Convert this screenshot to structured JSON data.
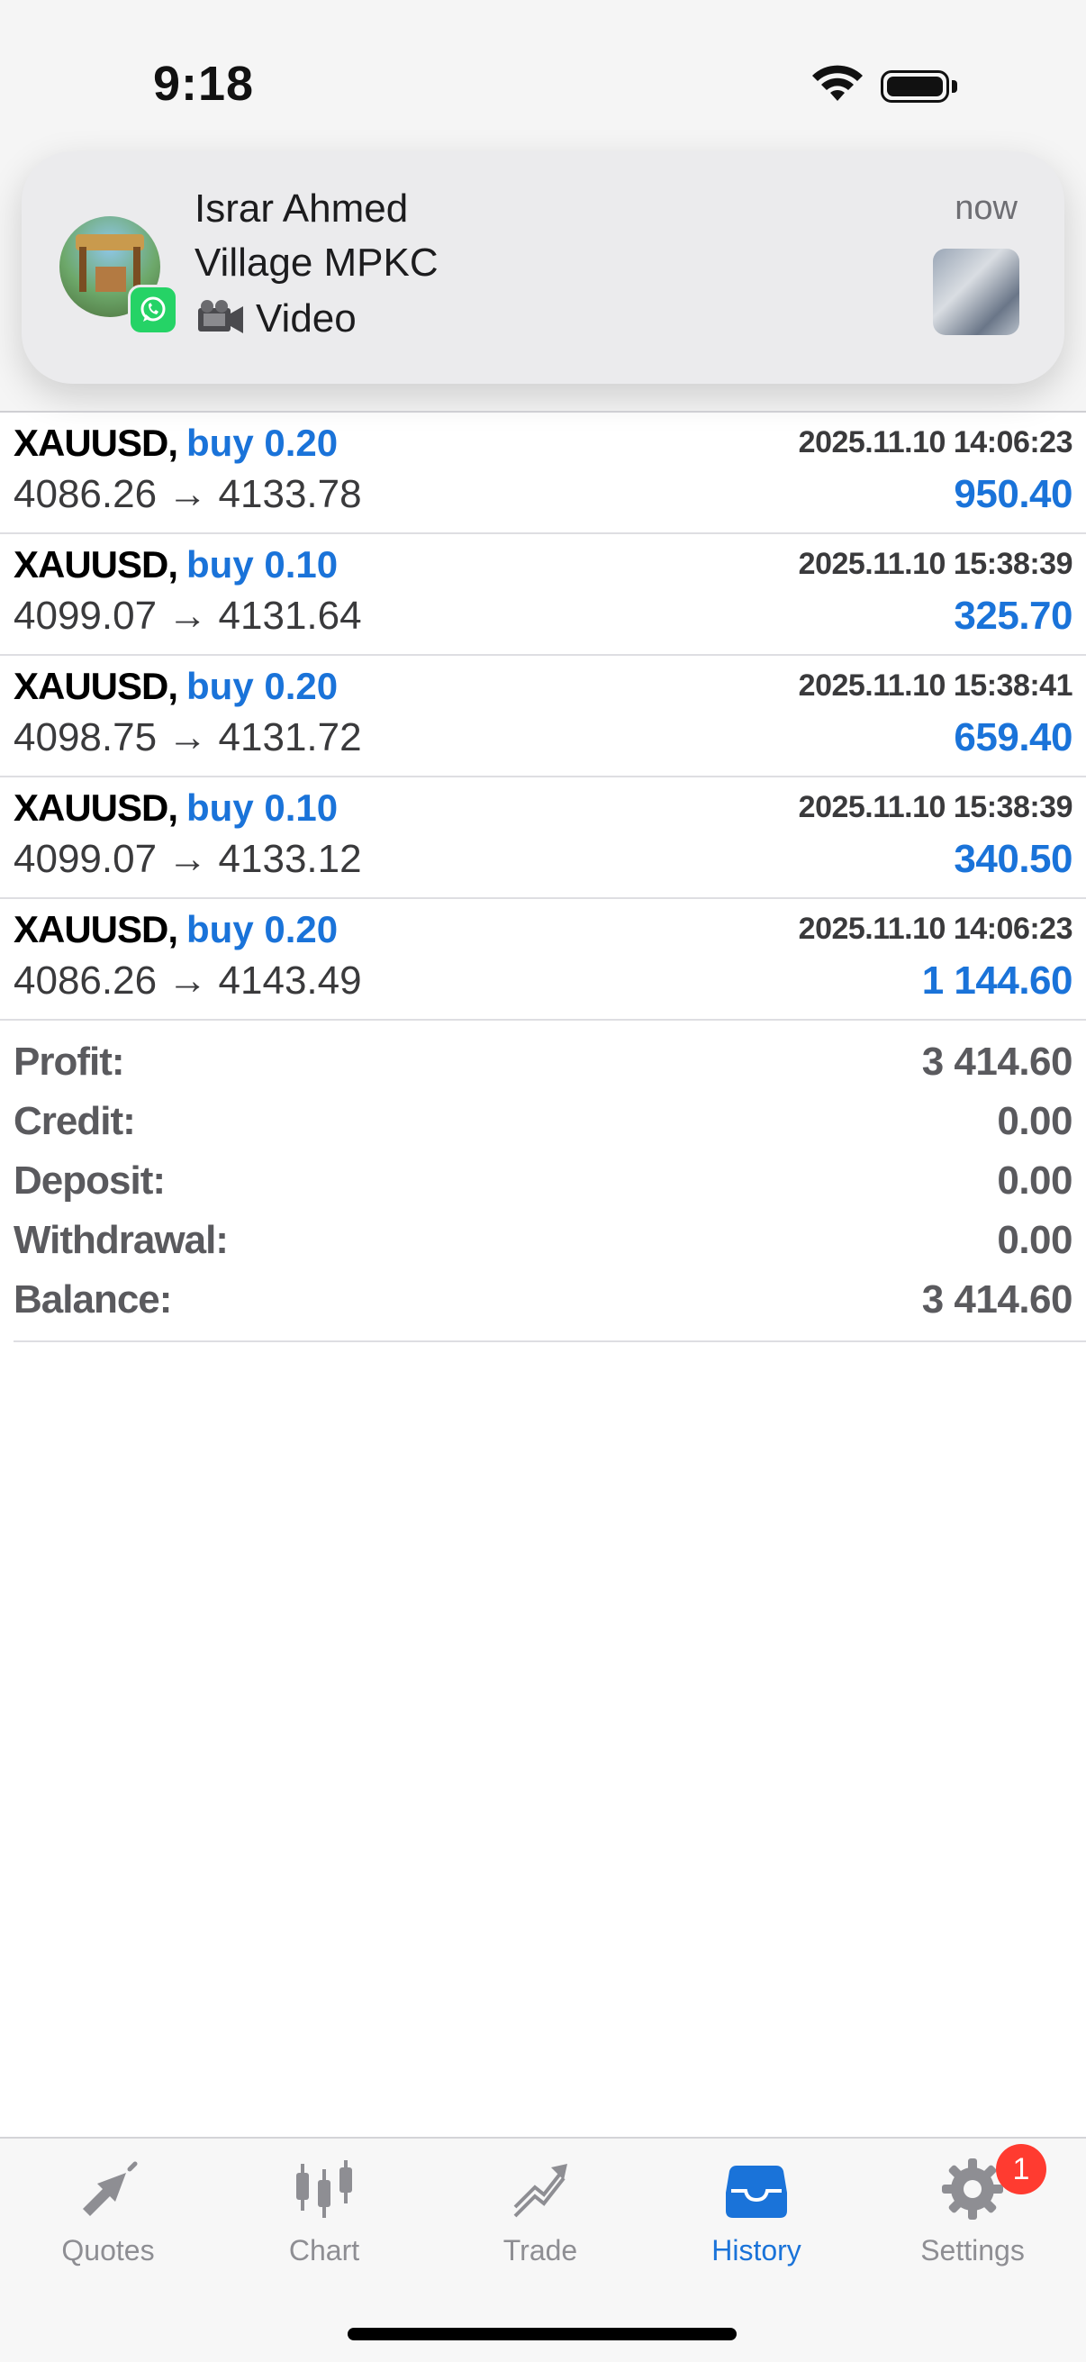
{
  "status_bar": {
    "time": "9:18"
  },
  "notification": {
    "sender": "Israr Ahmed",
    "group": "Village MPKC",
    "message": "Video",
    "time": "now"
  },
  "deals": [
    {
      "symbol": "XAUUSD,",
      "type": "buy 0.20",
      "open_price": "4086.26",
      "close_price": "4133.78",
      "time": "2025.11.10 14:06:23",
      "profit": "950.40"
    },
    {
      "symbol": "XAUUSD,",
      "type": "buy 0.10",
      "open_price": "4099.07",
      "close_price": "4131.64",
      "time": "2025.11.10 15:38:39",
      "profit": "325.70"
    },
    {
      "symbol": "XAUUSD,",
      "type": "buy 0.20",
      "open_price": "4098.75",
      "close_price": "4131.72",
      "time": "2025.11.10 15:38:41",
      "profit": "659.40"
    },
    {
      "symbol": "XAUUSD,",
      "type": "buy 0.10",
      "open_price": "4099.07",
      "close_price": "4133.12",
      "time": "2025.11.10 15:38:39",
      "profit": "340.50"
    },
    {
      "symbol": "XAUUSD,",
      "type": "buy 0.20",
      "open_price": "4086.26",
      "close_price": "4143.49",
      "time": "2025.11.10 14:06:23",
      "profit": "1 144.60"
    }
  ],
  "arrow": "→",
  "summary": [
    {
      "label": "Profit:",
      "value": "3 414.60"
    },
    {
      "label": "Credit:",
      "value": "0.00"
    },
    {
      "label": "Deposit:",
      "value": "0.00"
    },
    {
      "label": "Withdrawal:",
      "value": "0.00"
    },
    {
      "label": "Balance:",
      "value": "3 414.60"
    }
  ],
  "tabs": [
    {
      "label": "Quotes",
      "icon": "quotes-icon",
      "active": false
    },
    {
      "label": "Chart",
      "icon": "chart-icon",
      "active": false
    },
    {
      "label": "Trade",
      "icon": "trade-icon",
      "active": false
    },
    {
      "label": "History",
      "icon": "history-icon",
      "active": true
    },
    {
      "label": "Settings",
      "icon": "settings-icon",
      "active": false
    }
  ],
  "settings_badge": "1",
  "colors": {
    "accent": "#1a73d9",
    "inactive": "#8e8e93",
    "badge": "#ff3b30"
  }
}
